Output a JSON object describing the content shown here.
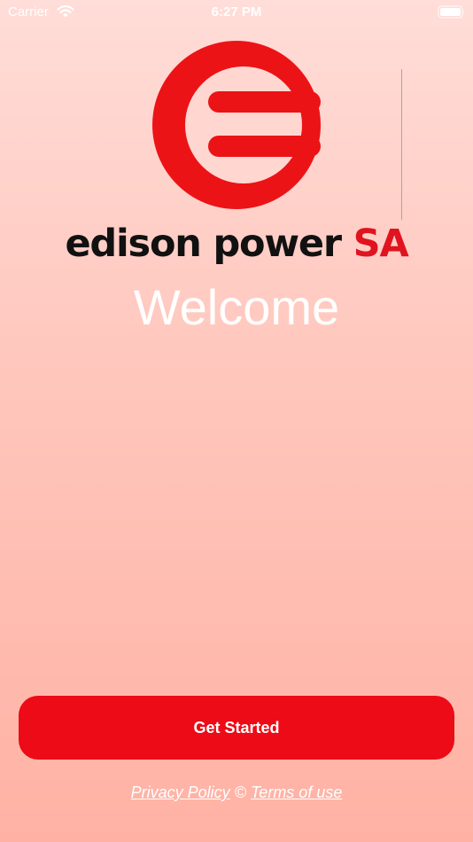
{
  "status_bar": {
    "carrier": "Carrier",
    "time": "6:27 PM",
    "wifi_icon": "wifi-icon",
    "battery_icon": "battery-icon"
  },
  "logo": {
    "icon": "edison-logo-icon",
    "name": "edison power",
    "suffix": "SA",
    "accent_color": "#e0131f"
  },
  "welcome": {
    "title": "Welcome"
  },
  "actions": {
    "get_started_label": "Get Started",
    "button_color": "#ec0b16"
  },
  "legal": {
    "privacy_label": "Privacy Policy",
    "separator": "©",
    "terms_label": "Terms of use"
  }
}
